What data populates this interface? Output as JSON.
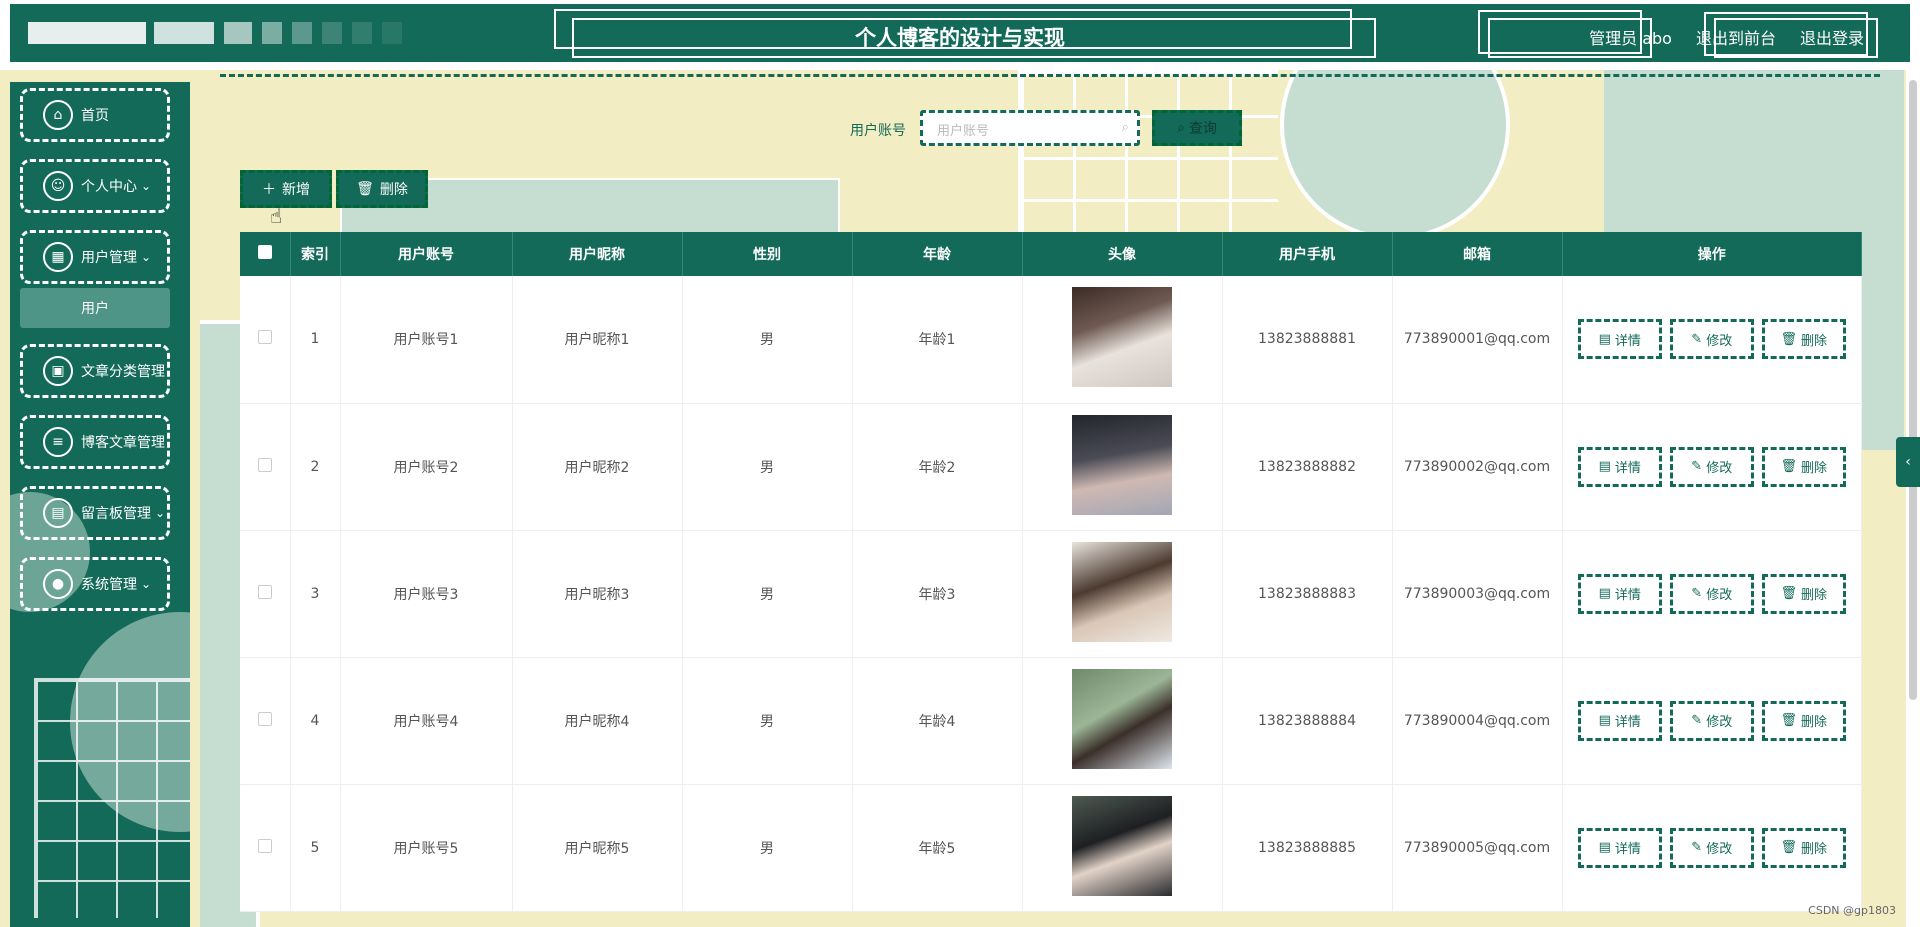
{
  "header": {
    "title": "个人博客的设计与实现",
    "admin_label": "管理员 abo",
    "front_link": "退出到前台",
    "logout_link": "退出登录"
  },
  "sidebar": {
    "items": [
      {
        "label": "首页",
        "icon": "home-icon"
      },
      {
        "label": "个人中心",
        "icon": "user-icon"
      },
      {
        "label": "用户管理",
        "icon": "grid-icon"
      },
      {
        "label": "文章分类管理",
        "icon": "document-icon"
      },
      {
        "label": "博客文章管理",
        "icon": "list-icon"
      },
      {
        "label": "留言板管理",
        "icon": "box-icon"
      },
      {
        "label": "系统管理",
        "icon": "settings-icon"
      }
    ],
    "sub_item": "用户"
  },
  "search": {
    "label": "用户账号",
    "placeholder": "用户账号",
    "button": "查询"
  },
  "toolbar": {
    "add": "新增",
    "delete": "删除"
  },
  "table": {
    "headers": [
      "索引",
      "用户账号",
      "用户昵称",
      "性别",
      "年龄",
      "头像",
      "用户手机",
      "邮箱",
      "操作"
    ],
    "rows": [
      {
        "index": "1",
        "account": "用户账号1",
        "nickname": "用户昵称1",
        "gender": "男",
        "age": "年龄1",
        "phone": "13823888881",
        "email": "773890001@qq.com"
      },
      {
        "index": "2",
        "account": "用户账号2",
        "nickname": "用户昵称2",
        "gender": "男",
        "age": "年龄2",
        "phone": "13823888882",
        "email": "773890002@qq.com"
      },
      {
        "index": "3",
        "account": "用户账号3",
        "nickname": "用户昵称3",
        "gender": "男",
        "age": "年龄3",
        "phone": "13823888883",
        "email": "773890003@qq.com"
      },
      {
        "index": "4",
        "account": "用户账号4",
        "nickname": "用户昵称4",
        "gender": "男",
        "age": "年龄4",
        "phone": "13823888884",
        "email": "773890004@qq.com"
      },
      {
        "index": "5",
        "account": "用户账号5",
        "nickname": "用户昵称5",
        "gender": "男",
        "age": "年龄5",
        "phone": "13823888885",
        "email": "773890005@qq.com"
      }
    ],
    "ops": {
      "detail": "详情",
      "edit": "修改",
      "delete": "删除"
    }
  },
  "watermark": "CSDN @gp1803",
  "colors": {
    "primary": "#136a59",
    "background": "#f3edc3",
    "accent_light": "#c6ddd2"
  }
}
